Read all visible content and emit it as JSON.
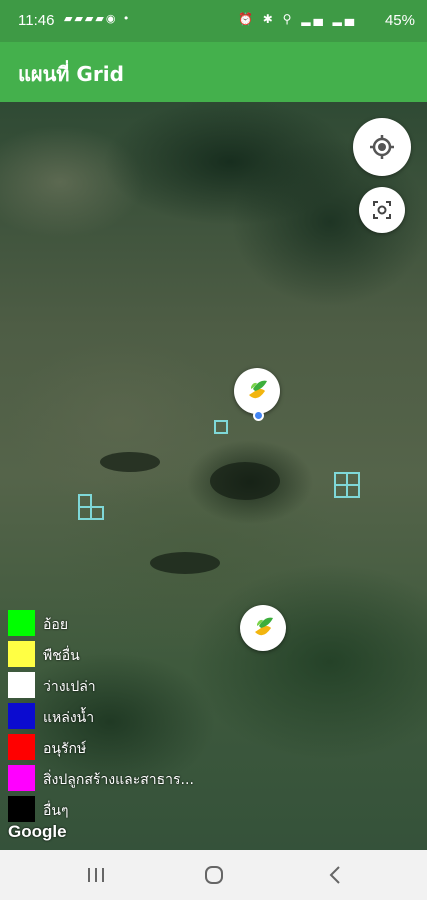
{
  "status_bar": {
    "time": "11:46",
    "battery": "45%"
  },
  "app_bar": {
    "title": "แผนที่ Grid"
  },
  "map": {
    "attribution": "Google"
  },
  "legend": {
    "items": [
      {
        "label": "อ้อย",
        "color": "#00ff00"
      },
      {
        "label": "พืชอื่น",
        "color": "#ffff44"
      },
      {
        "label": "ว่างเปล่า",
        "color": "#ffffff"
      },
      {
        "label": "แหล่งน้ำ",
        "color": "#0b0bd0"
      },
      {
        "label": "อนุรักษ์",
        "color": "#ff0000"
      },
      {
        "label": "สิ่งปลูกสร้างและสาธาร...",
        "color": "#ff00ff"
      },
      {
        "label": "อื่นๆ",
        "color": "#000000"
      }
    ]
  },
  "colors": {
    "status_bar": "#3e9a45",
    "app_bar": "#44b04c",
    "grid_outline": "#7fd8d8",
    "location_dot": "#4285f4"
  }
}
